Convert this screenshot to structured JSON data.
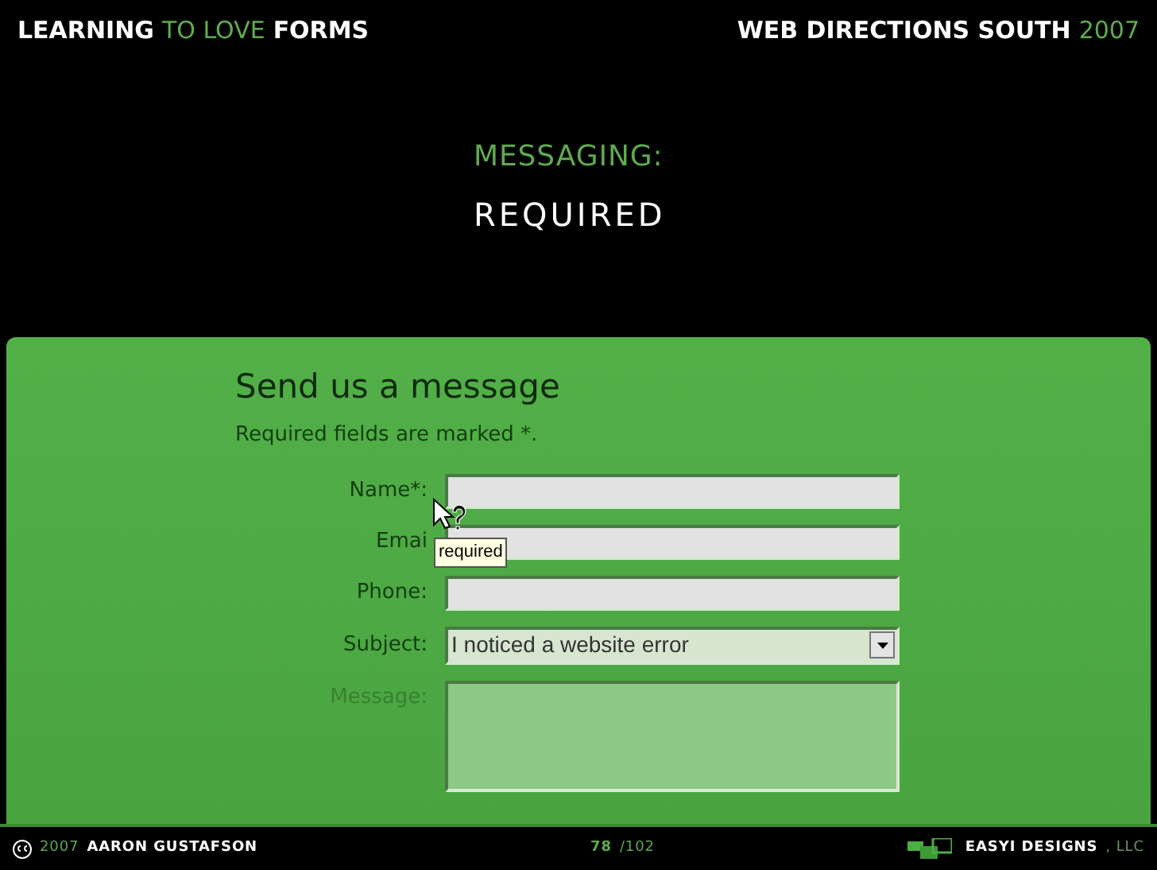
{
  "header": {
    "left": [
      {
        "text": "LEARNING",
        "kind": "strong"
      },
      {
        "text": "TO LOVE",
        "kind": "light"
      },
      {
        "text": "FORMS",
        "kind": "strong"
      }
    ],
    "right": [
      {
        "text": "WEB DIRECTIONS SOUTH",
        "kind": "strong"
      },
      {
        "text": "2007",
        "kind": "light"
      }
    ]
  },
  "slide": {
    "kicker": "MESSAGING:",
    "title": "REQUIRED"
  },
  "form": {
    "heading": "Send us a message",
    "note": "Required fields are marked *.",
    "fields": [
      {
        "label": "Name*:",
        "kind": "text",
        "disabled": false
      },
      {
        "label": "Emai",
        "kind": "text",
        "disabled": false
      },
      {
        "label": "Phone:",
        "kind": "text",
        "disabled": false
      },
      {
        "label": "Subject:",
        "kind": "select",
        "value": "I noticed a website error",
        "disabled": false
      },
      {
        "label": "Message:",
        "kind": "textarea",
        "disabled": true
      }
    ],
    "tooltip": "required"
  },
  "footer": {
    "left": [
      {
        "text": "2007",
        "kind": "light"
      },
      {
        "text": "AARON GUSTAFSON",
        "kind": "strong"
      }
    ],
    "page": [
      {
        "text": "78",
        "kind": "accent"
      },
      {
        "text": "/102",
        "kind": "light"
      }
    ],
    "right": [
      {
        "text": "EASYI DESIGNS",
        "kind": "strong"
      },
      {
        "text": ", LLC",
        "kind": "dim"
      }
    ]
  }
}
